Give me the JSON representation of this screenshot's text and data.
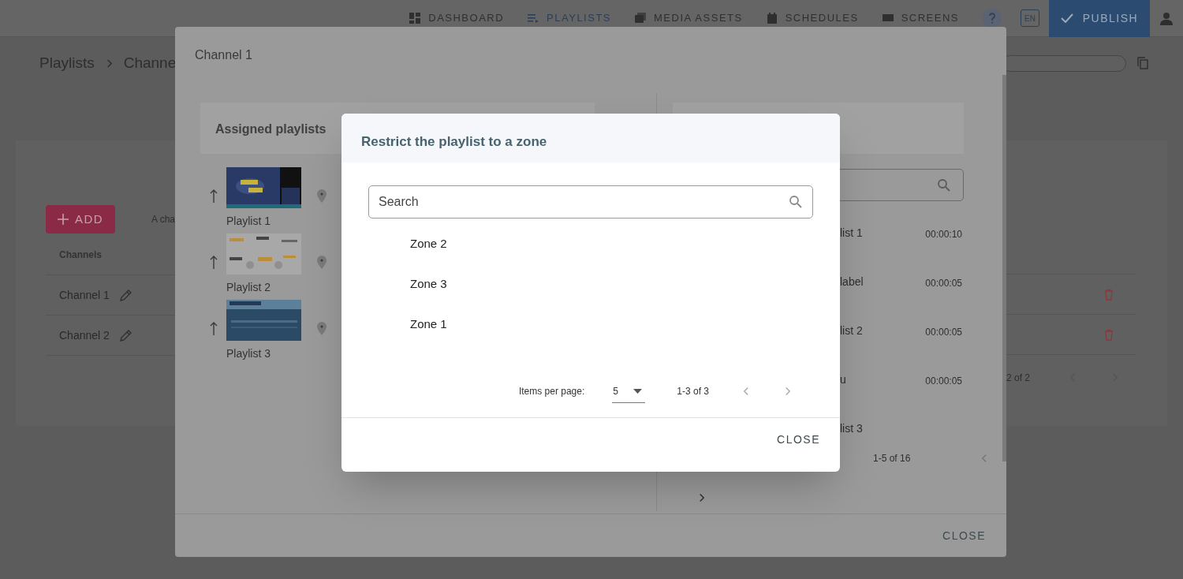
{
  "nav": {
    "items": [
      {
        "label": "DASHBOARD",
        "selected": false
      },
      {
        "label": "PLAYLISTS",
        "selected": true
      },
      {
        "label": "MEDIA ASSETS",
        "selected": false
      },
      {
        "label": "SCHEDULES",
        "selected": false
      },
      {
        "label": "SCREENS",
        "selected": false
      }
    ],
    "language": "EN",
    "publish": "PUBLISH"
  },
  "breadcrumb": [
    "Playlists",
    "Channe"
  ],
  "channels_card": {
    "add": "ADD",
    "description": "A cha",
    "column": "Channels",
    "rows": [
      "Channel 1",
      "Channel 2"
    ],
    "pagination": "2 of 2"
  },
  "channel_dialog": {
    "title": "Channel 1",
    "assigned_title": "Assigned playlists",
    "assigned": [
      {
        "name": "Playlist 1"
      },
      {
        "name": "Playlist 2"
      },
      {
        "name": "Playlist 3"
      }
    ],
    "available": [
      {
        "name": "list 1",
        "duration": "00:00:10"
      },
      {
        "name": "label",
        "duration": "00:00:05"
      },
      {
        "name": "list 2",
        "duration": "00:00:05"
      },
      {
        "name": "u",
        "duration": "00:00:05"
      },
      {
        "name": "list 3"
      }
    ],
    "pagination": "1-5 of 16",
    "close": "CLOSE"
  },
  "zone_dialog": {
    "title": "Restrict the playlist to a zone",
    "search": {
      "placeholder": "Search"
    },
    "zones": [
      "Zone 2",
      "Zone 3",
      "Zone 1"
    ],
    "items_per_page_label": "Items per page:",
    "items_per_page": "5",
    "range": "1-3 of 3",
    "close": "CLOSE"
  }
}
